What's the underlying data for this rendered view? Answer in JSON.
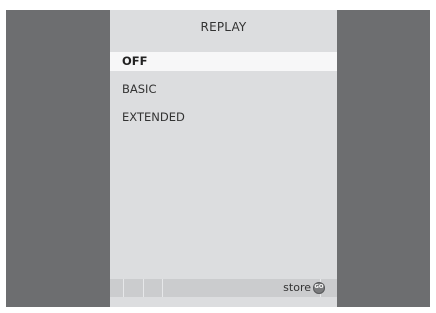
{
  "menu": {
    "title": "REPLAY",
    "items": [
      {
        "label": "OFF",
        "selected": true
      },
      {
        "label": "BASIC",
        "selected": false
      },
      {
        "label": "EXTENDED",
        "selected": false
      }
    ]
  },
  "footer": {
    "action_label": "store",
    "go_button_label": "GO",
    "go_icon": "go-button-icon"
  },
  "colors": {
    "background": "#6d6e70",
    "panel": "#dcdddf",
    "highlight": "#f7f7f8"
  }
}
